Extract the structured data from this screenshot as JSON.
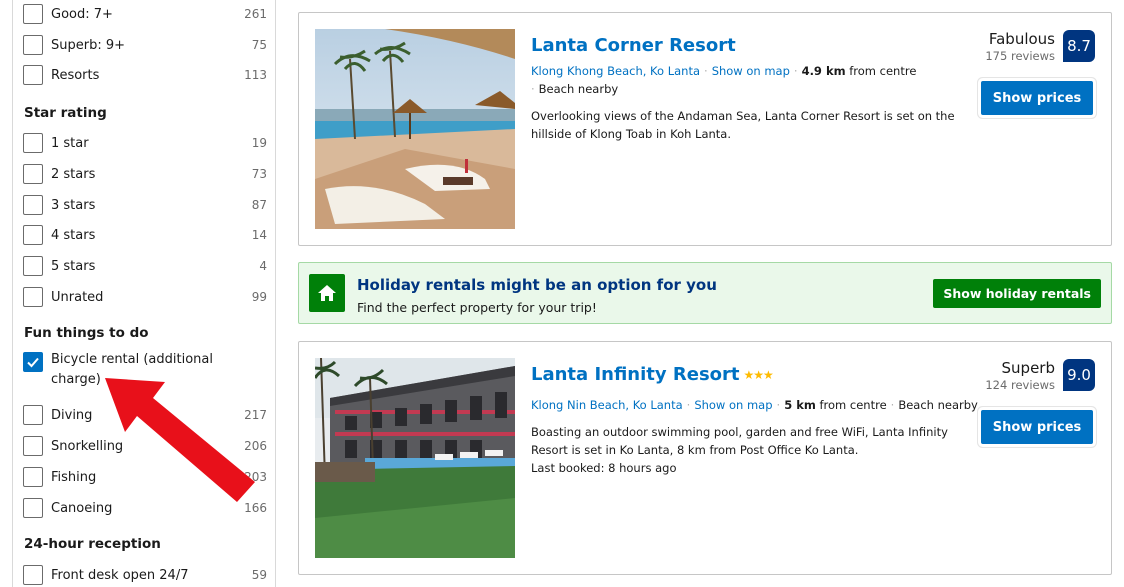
{
  "filters": {
    "review_score": [
      {
        "label": "Good: 7+",
        "count": "261",
        "checked": false
      },
      {
        "label": "Superb: 9+",
        "count": "75",
        "checked": false
      },
      {
        "label": "Resorts",
        "count": "113",
        "checked": false
      }
    ],
    "star_rating": {
      "title": "Star rating",
      "items": [
        {
          "label": "1 star",
          "count": "19",
          "checked": false
        },
        {
          "label": "2 stars",
          "count": "73",
          "checked": false
        },
        {
          "label": "3 stars",
          "count": "87",
          "checked": false
        },
        {
          "label": "4 stars",
          "count": "14",
          "checked": false
        },
        {
          "label": "5 stars",
          "count": "4",
          "checked": false
        },
        {
          "label": "Unrated",
          "count": "99",
          "checked": false
        }
      ]
    },
    "fun_things": {
      "title": "Fun things to do",
      "items": [
        {
          "label": "Bicycle rental (additional charge)",
          "label_line1": "Bicycle rental (additional",
          "label_line2": "charge)",
          "count": "",
          "checked": true
        },
        {
          "label": "Diving",
          "count": "217",
          "checked": false
        },
        {
          "label": "Snorkelling",
          "count": "206",
          "checked": false
        },
        {
          "label": "Fishing",
          "count": "203",
          "checked": false
        },
        {
          "label": "Canoeing",
          "count": "166",
          "checked": false
        }
      ]
    },
    "reception": {
      "title": "24-hour reception",
      "items": [
        {
          "label": "Front desk open 24/7",
          "count": "59",
          "checked": false
        }
      ]
    }
  },
  "banner": {
    "title": "Holiday rentals might be an option for you",
    "subtitle": "Find the perfect property for your trip!",
    "button": "Show holiday rentals"
  },
  "hotels": [
    {
      "name": "Lanta Corner Resort",
      "location": "Klong Khong Beach, Ko Lanta",
      "show_on_map": "Show on map",
      "distance": "4.9 km",
      "distance_suffix": "from centre",
      "beach": "Beach nearby",
      "description": "Overlooking views of the Andaman Sea, Lanta Corner Resort is set on the hillside of Klong Toab in Koh Lanta.",
      "rating_word": "Fabulous",
      "reviews": "175 reviews",
      "score": "8.7",
      "button": "Show prices"
    },
    {
      "name": "Lanta Infinity Resort",
      "stars": "★★★",
      "location": "Klong Nin Beach, Ko Lanta",
      "show_on_map": "Show on map",
      "distance": "5 km",
      "distance_suffix": "from centre",
      "beach": "Beach nearby",
      "description": "Boasting an outdoor swimming pool, garden and free WiFi, Lanta Infinity Resort is set in Ko Lanta, 8 km from Post Office Ko Lanta.",
      "last_booked": "Last booked: 8 hours ago",
      "rating_word": "Superb",
      "reviews": "124 reviews",
      "score": "9.0",
      "button": "Show prices"
    }
  ],
  "colors": {
    "link_blue": "#0071c2",
    "score_navy": "#003580",
    "green": "#008009",
    "annotation_red": "#e8101a"
  }
}
